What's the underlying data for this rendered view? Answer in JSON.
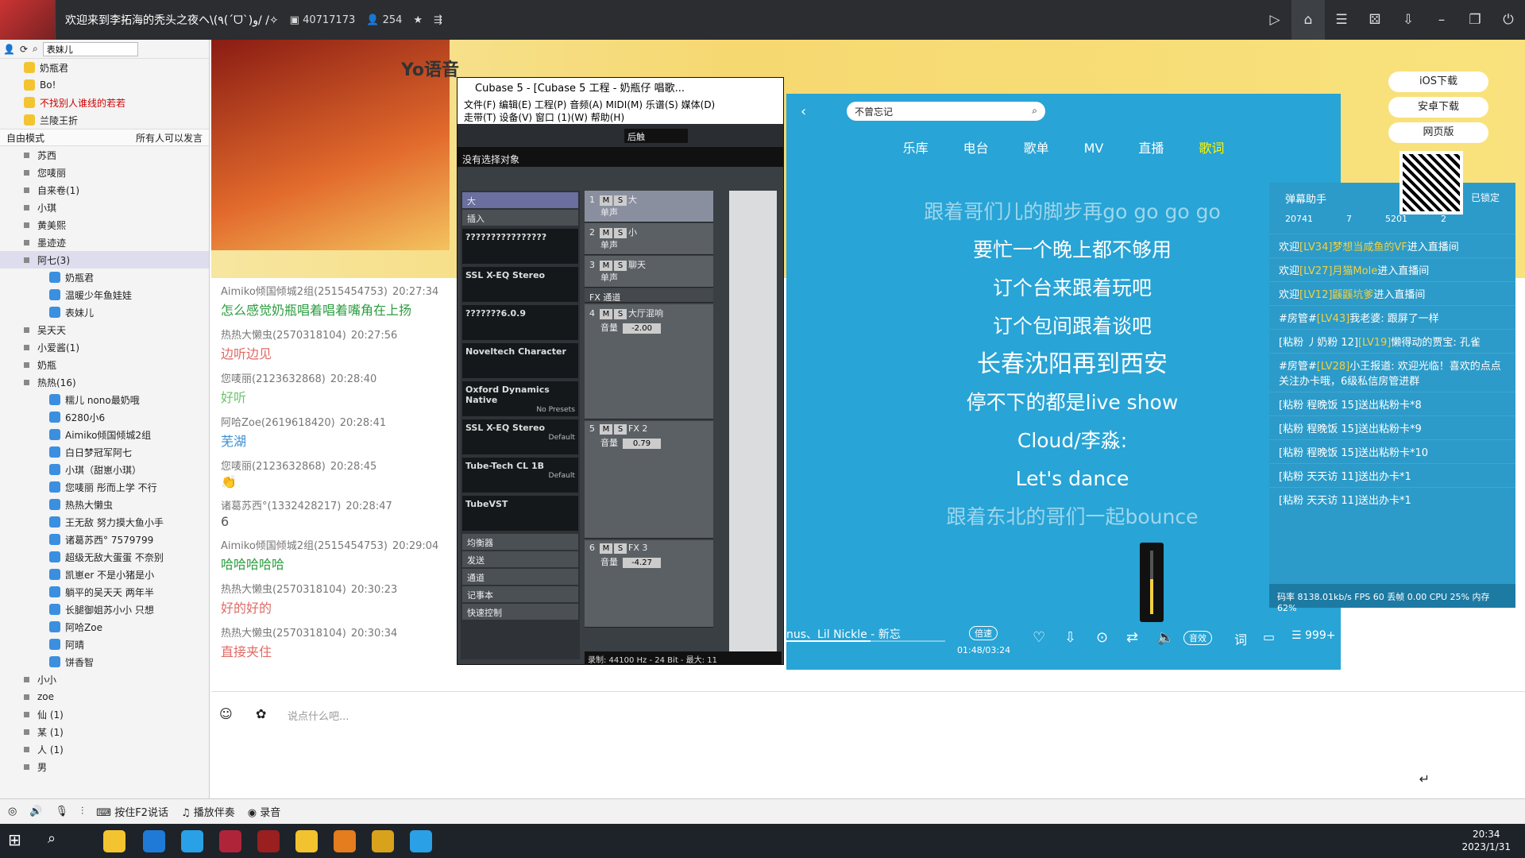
{
  "window": {
    "title": "欢迎来到李拓海的秃头之夜ヘ\\(٩(ˊᗜˋ)و/ /✧",
    "room_id": "40717173",
    "online": "254"
  },
  "sidebar": {
    "search_value": "表妹儿",
    "top_users": [
      "奶瓶君",
      "Bo!",
      "不找别人谁线的若若",
      "兰陵王折"
    ],
    "mode_label": "自由模式",
    "mode_hint": "所有人可以发言",
    "channels": [
      "苏西",
      "您唛丽",
      "自来卷(1)",
      "小琪",
      "黄美熙",
      "墨迹迹",
      "阿七(3)"
    ],
    "channel_members": [
      "奶瓶君",
      "温暖少年鱼娃娃",
      "表妹儿"
    ],
    "channels2": [
      "吴天天",
      "小爱酱(1)",
      "奶瓶",
      "热热(16)"
    ],
    "members": [
      "糯儿 nono最奶哦",
      "6280小6",
      "Aimiko倾国倾城2组",
      "白日梦冠军阿七",
      "小琪（甜崽小琪）",
      "您唛丽 彤而上学 不行",
      "热热大懒虫",
      "王无敌 努力摸大鱼小手",
      "诸葛苏西° 7579799",
      "超级无敌大蛋蛋 不奈别",
      "凯崽er 不是小猪是小",
      "躺平的吴天天 两年半",
      "长腿御姐苏小小 只想",
      "阿哈Zoe",
      "阿晴",
      "饼香智"
    ],
    "channels3": [
      "小小",
      "zoe"
    ],
    "extra": [
      "仙 (1)",
      "某 (1)",
      "人 (1)",
      "男"
    ]
  },
  "banner": {
    "brand": "Yo语音"
  },
  "chat": [
    {
      "who": "Aimiko倾国倾城2组(2515454753)",
      "time": "20:27:34",
      "text": "怎么感觉奶瓶唱着唱着嘴角在上扬",
      "color": "#2a9d3f"
    },
    {
      "who": "热热大懒虫(2570318104)",
      "time": "20:27:56",
      "text": "边听边见",
      "color": "#e06a66"
    },
    {
      "who": "您唛丽(2123632868)",
      "time": "20:28:40",
      "text": "好听",
      "color": "#6cc36c"
    },
    {
      "who": "阿哈Zoe(2619618420)",
      "time": "20:28:41",
      "text": "芜湖",
      "color": "#3a8fd0"
    },
    {
      "who": "您唛丽(2123632868)",
      "time": "20:28:45",
      "text": "👏",
      "color": "#6cc36c"
    },
    {
      "who": "诸葛苏西°(1332428217)",
      "time": "20:28:47",
      "text": "6",
      "color": "#555"
    },
    {
      "who": "Aimiko倾国倾城2组(2515454753)",
      "time": "20:29:04",
      "text": "哈哈哈哈哈",
      "color": "#2a9d3f"
    },
    {
      "who": "热热大懒虫(2570318104)",
      "time": "20:30:23",
      "text": "好的好的",
      "color": "#e06a66"
    },
    {
      "who": "热热大懒虫(2570318104)",
      "time": "20:30:34",
      "text": "直接夹住",
      "color": "#e06a66"
    }
  ],
  "input": {
    "placeholder": "说点什么吧..."
  },
  "bottombar": [
    "按住F2说话",
    "播放伴奏",
    "录音"
  ],
  "cubase": {
    "title": "Cubase 5 - [Cubase 5 工程 - 奶瓶仔 唱歌...",
    "menu1": "文件(F)  编辑(E)  工程(P)  音频(A)  MIDI(M)  乐谱(S)  媒体(D)",
    "menu2": "走带(T)  设备(V)  窗口 (1)(W)  帮助(H)",
    "preset": "后触",
    "no_object": "没有选择对象",
    "track_sel": "大",
    "insert_label": "插入",
    "slots": [
      {
        "name": "????????????????",
        "sub": ""
      },
      {
        "name": "SSL X-EQ Stereo",
        "sub": ""
      },
      {
        "name": "???????6.0.9",
        "sub": ""
      },
      {
        "name": "Noveltech Character",
        "sub": ""
      },
      {
        "name": "Oxford Dynamics Native",
        "sub": "No Presets"
      },
      {
        "name": "SSL X-EQ Stereo",
        "sub": "Default"
      },
      {
        "name": "Tube-Tech CL 1B",
        "sub": "Default"
      },
      {
        "name": "TubeVST",
        "sub": ""
      }
    ],
    "insp_rows": [
      "均衡器",
      "发送",
      "通道",
      "记事本",
      "快速控制"
    ],
    "tracks": [
      {
        "num": "1",
        "name": "大",
        "type": "单声"
      },
      {
        "num": "2",
        "name": "小",
        "type": "单声"
      },
      {
        "num": "3",
        "name": "聊天",
        "type": "单声"
      }
    ],
    "fx_folder": "FX 通道",
    "fx": [
      {
        "num": "4",
        "name": "大厅混响",
        "vol_label": "音量",
        "vol": "-2.00"
      },
      {
        "num": "5",
        "name": "FX 2",
        "vol_label": "音量",
        "vol": "0.79"
      },
      {
        "num": "6",
        "name": "FX 3",
        "vol_label": "音量",
        "vol": "-4.27"
      }
    ],
    "status": "录制: 44100 Hz - 24 Bit - 最大: 11"
  },
  "player": {
    "search": "不曾忘记",
    "nav": [
      "乐库",
      "电台",
      "歌单",
      "MV",
      "直播",
      "歌词"
    ],
    "nav_active": 5,
    "lyrics": [
      {
        "t": "跟着哥们儿的脚步再go go go go",
        "c": "dim"
      },
      {
        "t": "要忙一个晚上都不够用",
        "c": ""
      },
      {
        "t": "订个台来跟着玩吧",
        "c": ""
      },
      {
        "t": "订个包间跟着谈吧",
        "c": ""
      },
      {
        "t": "长春沈阳再到西安",
        "c": "cur"
      },
      {
        "t": "停不下的都是live show",
        "c": ""
      },
      {
        "t": "Cloud/李淼:",
        "c": ""
      },
      {
        "t": "Let's dance",
        "c": ""
      },
      {
        "t": "跟着东北的哥们一起bounce",
        "c": "dim"
      }
    ],
    "song": "nus、Lil Nickle - 新忘",
    "speed": "倍速",
    "time": "01:48/03:24",
    "progress": 0.53,
    "volume": 0.55,
    "effect": "音效",
    "lyric_btn": "词",
    "playlist_count": "999+"
  },
  "danmu": {
    "title": "弹幕助手",
    "locked": "已锁定",
    "stats": [
      "20741",
      "7",
      "5201",
      "2"
    ],
    "lines": [
      {
        "pre": "欢迎",
        "hl": "[LV34]梦想当咸鱼的VF",
        "post": "进入直播间"
      },
      {
        "pre": "欢迎",
        "hl": "[LV27]月猫Mole",
        "post": "进入直播间"
      },
      {
        "pre": "欢迎",
        "hl": "[LV12]鼷鼷坑爹",
        "post": "进入直播间"
      },
      {
        "pre": "#房管#",
        "hl": "[LV43]",
        "post": "我老婆: 跟屏了一样"
      },
      {
        "pre": "[粘粉 丿奶粉 12]",
        "hl": "[LV19]",
        "post": "懒得动的贾宝: 孔雀"
      },
      {
        "pre": "#房管#",
        "hl": "[LV28]",
        "post": "小王报道: 欢迎光临！喜欢的点点关注办卡哦，6级私信房管进群"
      },
      {
        "pre": "[粘粉 程晚饭 15]",
        "hl": "",
        "post": "送出粘粉卡*8"
      },
      {
        "pre": "[粘粉 程晚饭 15]",
        "hl": "",
        "post": "送出粘粉卡*9"
      },
      {
        "pre": "[粘粉 程晚饭 15]",
        "hl": "",
        "post": "送出粘粉卡*10"
      },
      {
        "pre": "[粘粉 天天访 11]",
        "hl": "",
        "post": "送出办卡*1"
      },
      {
        "pre": "[粘粉 天天访 11]",
        "hl": "",
        "post": "送出办卡*1"
      }
    ],
    "foot": "码率 8138.01kb/s FPS 60 丢帧 0.00 CPU 25% 内存 62%"
  },
  "right": {
    "ios": "iOS下载",
    "android": "安卓下载",
    "web": "网页版"
  },
  "taskbar": {
    "time": "20:34",
    "date": "2023/1/31"
  }
}
